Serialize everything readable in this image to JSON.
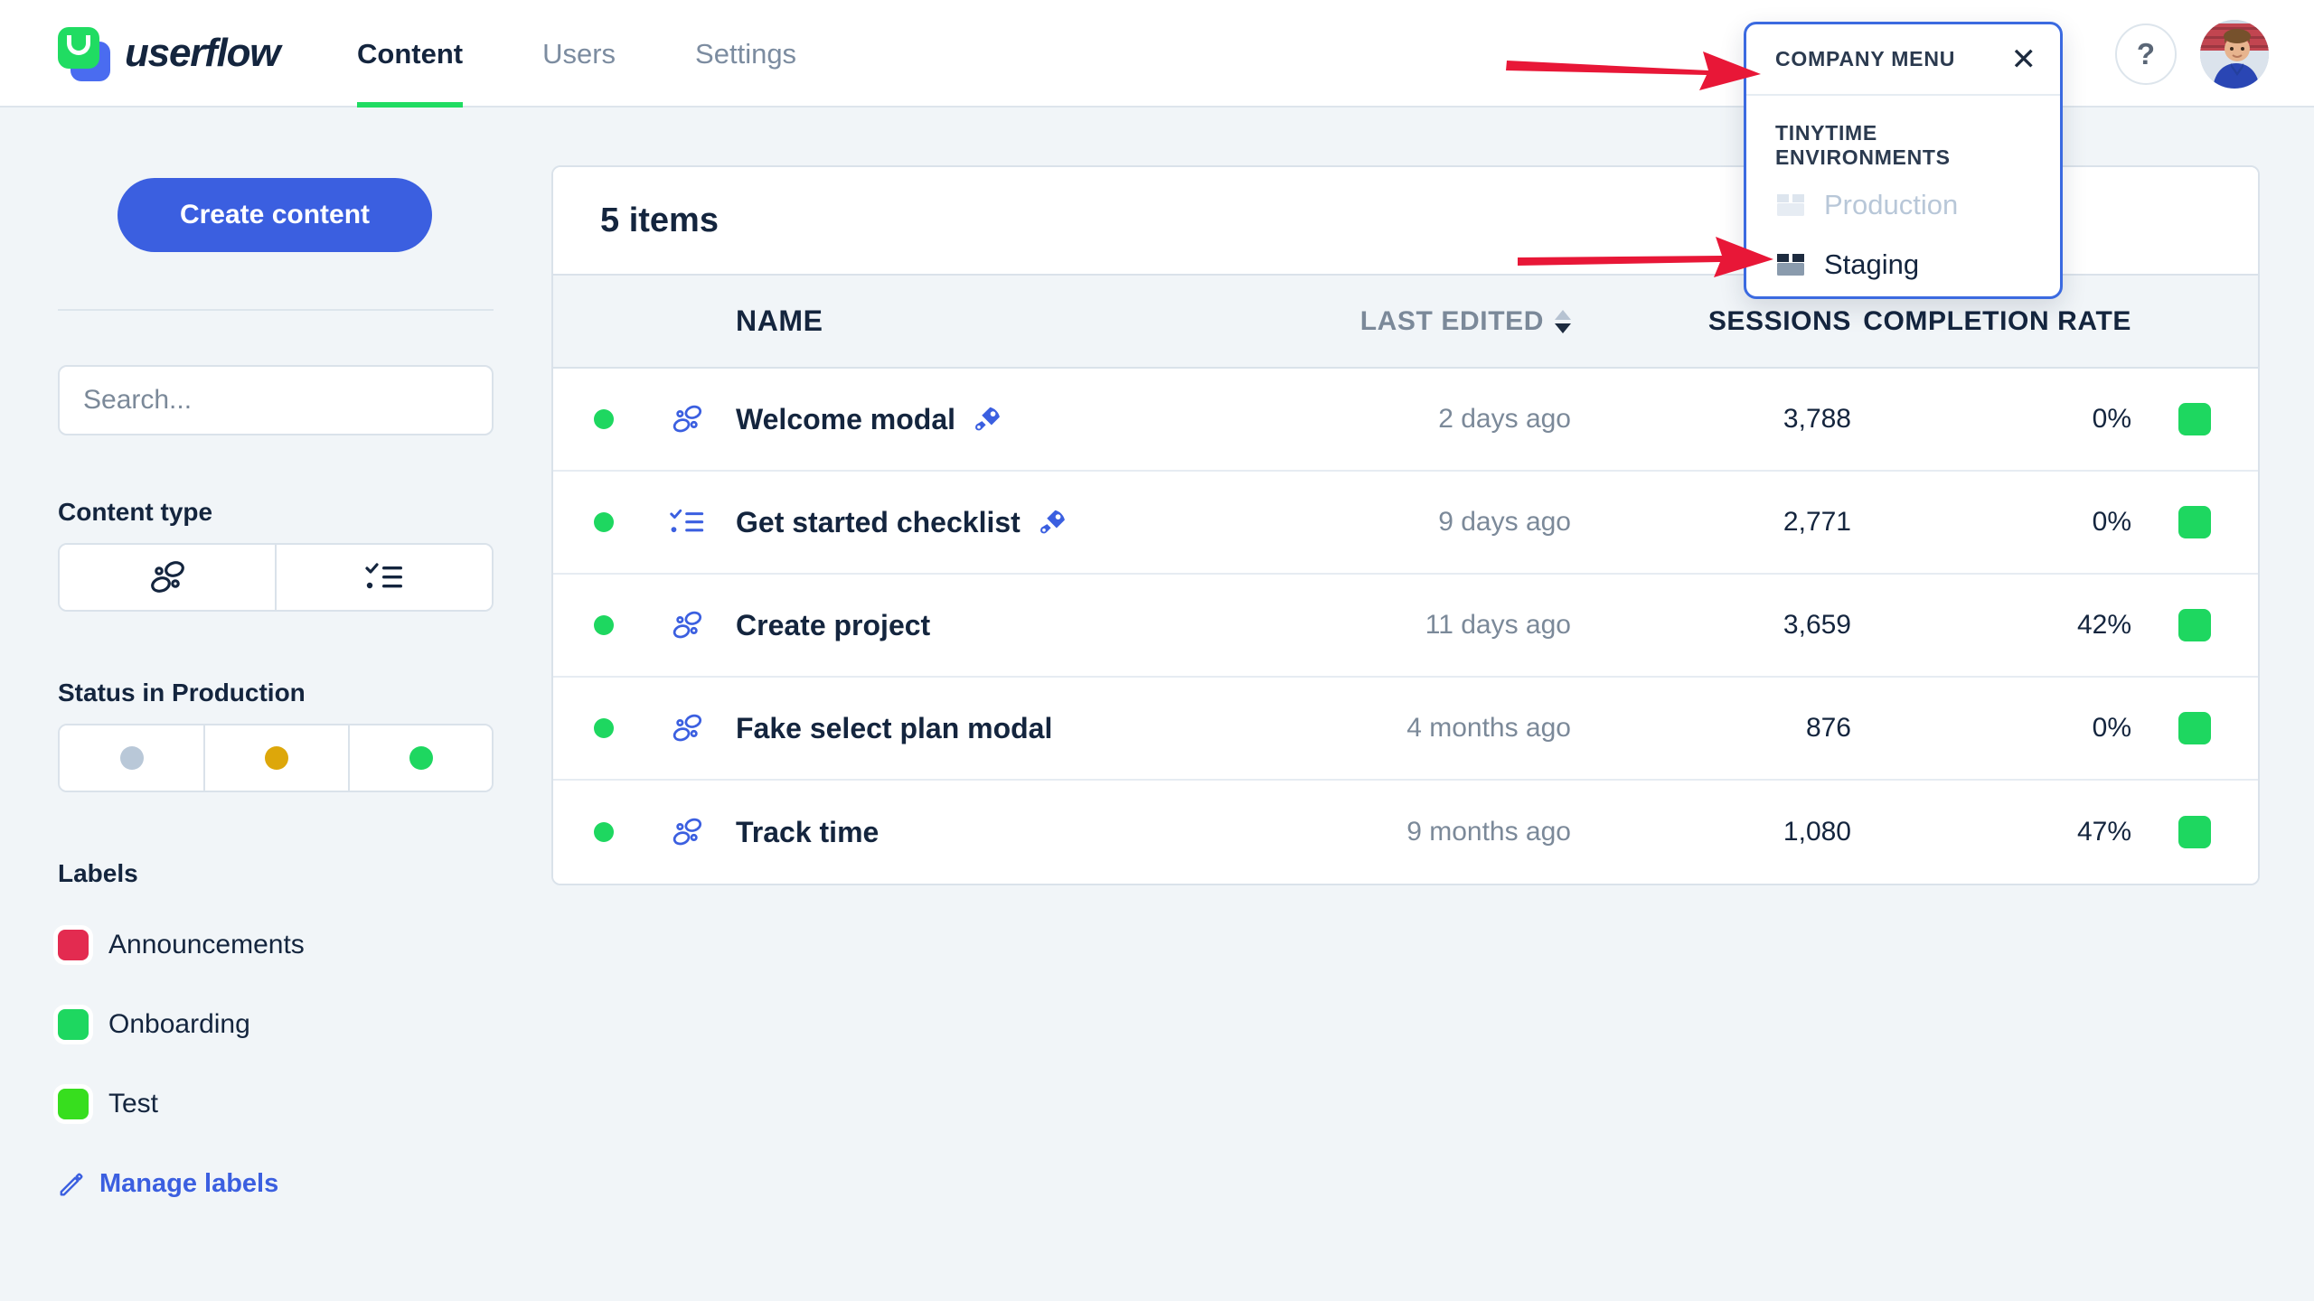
{
  "brand": {
    "name": "userflow",
    "logo_icon": "userflow-logo-icon",
    "green": "#20dc62",
    "blue": "#4a6cf0"
  },
  "nav": {
    "tabs": [
      {
        "label": "Content",
        "active": true
      },
      {
        "label": "Users",
        "active": false
      },
      {
        "label": "Settings",
        "active": false
      }
    ],
    "help_label": "?",
    "help_icon": "question-mark-icon",
    "avatar_icon": "user-avatar-photo"
  },
  "sidebar": {
    "create_button": "Create content",
    "search": {
      "placeholder": "Search...",
      "value": ""
    },
    "content_type": {
      "title": "Content type",
      "options": [
        {
          "icon": "flow-icon",
          "name": "flow"
        },
        {
          "icon": "checklist-icon",
          "name": "checklist"
        }
      ]
    },
    "status": {
      "title": "Status in Production",
      "options": [
        {
          "name": "draft",
          "color": "#b9c8d8"
        },
        {
          "name": "paused",
          "color": "#dda70a"
        },
        {
          "name": "live",
          "color": "#1ed760"
        }
      ]
    },
    "labels": {
      "title": "Labels",
      "items": [
        {
          "name": "Announcements",
          "color": "#e32b50"
        },
        {
          "name": "Onboarding",
          "color": "#1ed760"
        },
        {
          "name": "Test",
          "color": "#37de1e"
        }
      ],
      "manage_label": "Manage labels",
      "manage_icon": "pencil-icon"
    }
  },
  "main": {
    "item_count_label": "5 items",
    "columns": [
      "",
      "",
      "NAME",
      "LAST EDITED",
      "SESSIONS",
      "COMPLETION RATE",
      ""
    ],
    "sort": {
      "column": "LAST EDITED",
      "direction": "desc",
      "icon": "sort-arrows-icon"
    },
    "rows": [
      {
        "status_color": "#1ed760",
        "type_icon": "flow-icon",
        "name": "Welcome modal",
        "badge_icon": "rocket-icon",
        "last_edited": "2 days ago",
        "sessions": "3,788",
        "completion_rate": "0%",
        "label_color": "#1ed760"
      },
      {
        "status_color": "#1ed760",
        "type_icon": "checklist-icon",
        "name": "Get started checklist",
        "badge_icon": "rocket-icon",
        "last_edited": "9 days ago",
        "sessions": "2,771",
        "completion_rate": "0%",
        "label_color": "#1ed760"
      },
      {
        "status_color": "#1ed760",
        "type_icon": "flow-icon",
        "name": "Create project",
        "badge_icon": "",
        "last_edited": "11 days ago",
        "sessions": "3,659",
        "completion_rate": "42%",
        "label_color": "#1ed760"
      },
      {
        "status_color": "#1ed760",
        "type_icon": "flow-icon",
        "name": "Fake select plan modal",
        "badge_icon": "",
        "last_edited": "4 months ago",
        "sessions": "876",
        "completion_rate": "0%",
        "label_color": "#1ed760"
      },
      {
        "status_color": "#1ed760",
        "type_icon": "flow-icon",
        "name": "Track time",
        "badge_icon": "",
        "last_edited": "9 months ago",
        "sessions": "1,080",
        "completion_rate": "47%",
        "label_color": "#1ed760"
      }
    ]
  },
  "company_menu": {
    "title": "COMPANY MENU",
    "close_icon": "close-icon",
    "section_title": "TINYTIME ENVIRONMENTS",
    "items": [
      {
        "label": "Production",
        "icon": "box-icon",
        "state": "disabled"
      },
      {
        "label": "Staging",
        "icon": "box-icon",
        "state": "enabled"
      }
    ],
    "border_color": "#3b6ae0"
  },
  "annotations": {
    "arrow_color": "#e81737",
    "arrows": [
      {
        "name": "arrow-to-company-menu"
      },
      {
        "name": "arrow-to-staging"
      }
    ]
  }
}
